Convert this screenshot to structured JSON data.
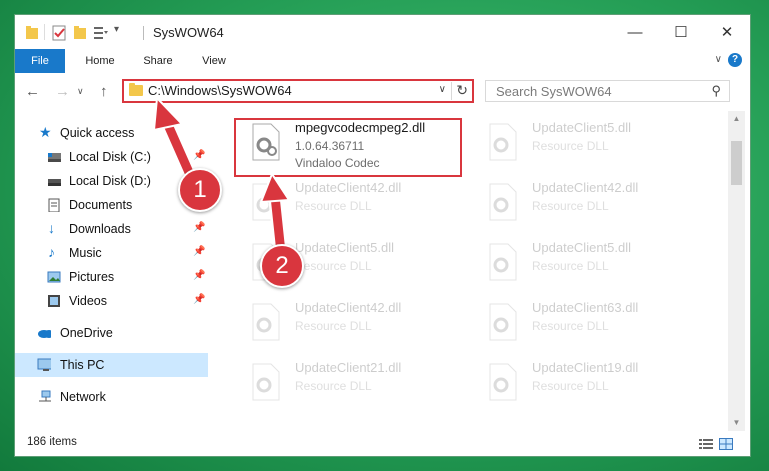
{
  "window": {
    "title": "SysWOW64",
    "controls": {
      "minimize": "—",
      "maximize": "☐",
      "close": "✕"
    }
  },
  "ribbon": {
    "tabs": [
      {
        "label": "File",
        "active": true
      },
      {
        "label": "Home"
      },
      {
        "label": "Share"
      },
      {
        "label": "View"
      }
    ],
    "help": "?"
  },
  "address_bar": {
    "path": "C:\\Windows\\SysWOW64",
    "highlighted": true
  },
  "search": {
    "placeholder": "Search SysWOW64"
  },
  "nav_pane": {
    "items": [
      {
        "label": "Quick access",
        "icon": "star-icon",
        "pinned": false
      },
      {
        "label": "Local Disk (C:)",
        "icon": "drive-icon",
        "pinned": true
      },
      {
        "label": "Local Disk (D:)",
        "icon": "drive-icon",
        "pinned": true
      },
      {
        "label": "Documents",
        "icon": "documents-icon",
        "pinned": true
      },
      {
        "label": "Downloads",
        "icon": "downloads-icon",
        "pinned": true
      },
      {
        "label": "Music",
        "icon": "music-icon",
        "pinned": true
      },
      {
        "label": "Pictures",
        "icon": "pictures-icon",
        "pinned": true
      },
      {
        "label": "Videos",
        "icon": "videos-icon",
        "pinned": true
      },
      {
        "label": "OneDrive",
        "icon": "onedrive-icon"
      },
      {
        "label": "This PC",
        "icon": "this-pc-icon",
        "selected": true
      },
      {
        "label": "Network",
        "icon": "network-icon"
      }
    ]
  },
  "files": [
    {
      "name": "mpegvcodecmpeg2.dll",
      "line2": "1.0.64.36711",
      "line3": "Vindaloo Codec",
      "highlighted": true
    },
    {
      "name": "UpdateClient5.dll",
      "line2": "Resource DLL",
      "faded": true
    },
    {
      "name": "UpdateClient42.dll",
      "line2": "Resource DLL",
      "faded": true
    },
    {
      "name": "UpdateClient42.dll",
      "line2": "Resource DLL",
      "faded": true
    },
    {
      "name": "UpdateClient5.dll",
      "line2": "Resource DLL",
      "faded": true
    },
    {
      "name": "UpdateClient5.dll",
      "line2": "Resource DLL",
      "faded": true
    },
    {
      "name": "UpdateClient42.dll",
      "line2": "Resource DLL",
      "faded": true
    },
    {
      "name": "UpdateClient63.dll",
      "line2": "Resource DLL",
      "faded": true
    },
    {
      "name": "UpdateClient21.dll",
      "line2": "Resource DLL",
      "faded": true
    },
    {
      "name": "UpdateClient19.dll",
      "line2": "Resource DLL",
      "faded": true
    }
  ],
  "status_bar": {
    "item_count": "186 items"
  },
  "annotations": {
    "step1": "1",
    "step2": "2",
    "color": "#d9363e"
  },
  "colors": {
    "accent": "#1979ca",
    "selection": "#cce8ff",
    "highlight": "#d9363e",
    "background": "#1f9a52"
  }
}
